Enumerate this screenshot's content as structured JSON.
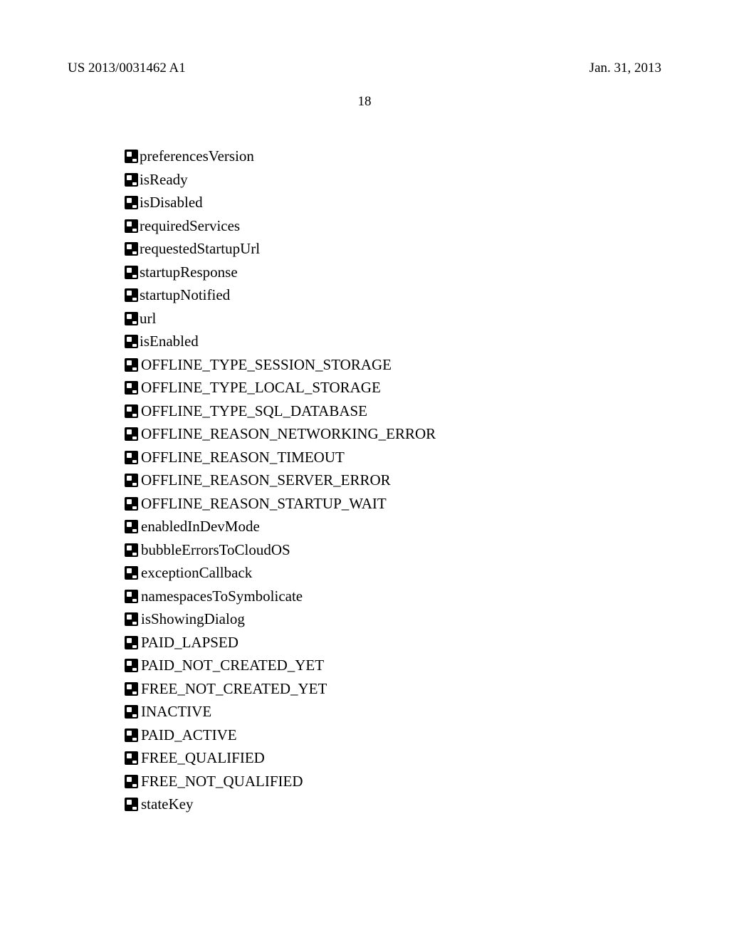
{
  "header": {
    "doc_number": "US 2013/0031462 A1",
    "date": "Jan. 31, 2013"
  },
  "page_number": "18",
  "properties": [
    {
      "label": "preferencesVersion",
      "spaced": false
    },
    {
      "label": "isReady",
      "spaced": false
    },
    {
      "label": "isDisabled",
      "spaced": false
    },
    {
      "label": "requiredServices",
      "spaced": false
    },
    {
      "label": "requestedStartupUrl",
      "spaced": false
    },
    {
      "label": "startupResponse",
      "spaced": false
    },
    {
      "label": "startupNotified",
      "spaced": false
    },
    {
      "label": "url",
      "spaced": false
    },
    {
      "label": "isEnabled",
      "spaced": false
    },
    {
      "label": "OFFLINE_TYPE_SESSION_STORAGE",
      "spaced": true
    },
    {
      "label": "OFFLINE_TYPE_LOCAL_STORAGE",
      "spaced": true
    },
    {
      "label": "OFFLINE_TYPE_SQL_DATABASE",
      "spaced": true
    },
    {
      "label": "OFFLINE_REASON_NETWORKING_ERROR",
      "spaced": true
    },
    {
      "label": "OFFLINE_REASON_TIMEOUT",
      "spaced": true
    },
    {
      "label": "OFFLINE_REASON_SERVER_ERROR",
      "spaced": true
    },
    {
      "label": "OFFLINE_REASON_STARTUP_WAIT",
      "spaced": true
    },
    {
      "label": "enabledInDevMode",
      "spaced": true
    },
    {
      "label": "bubbleErrorsToCloudOS",
      "spaced": true
    },
    {
      "label": "exceptionCallback",
      "spaced": true
    },
    {
      "label": "namespacesToSymbolicate",
      "spaced": true
    },
    {
      "label": "isShowingDialog",
      "spaced": true
    },
    {
      "label": "PAID_LAPSED",
      "spaced": true
    },
    {
      "label": "PAID_NOT_CREATED_YET",
      "spaced": true
    },
    {
      "label": "FREE_NOT_CREATED_YET",
      "spaced": true
    },
    {
      "label": "INACTIVE",
      "spaced": true
    },
    {
      "label": "PAID_ACTIVE",
      "spaced": true
    },
    {
      "label": "FREE_QUALIFIED",
      "spaced": true
    },
    {
      "label": "FREE_NOT_QUALIFIED",
      "spaced": true
    },
    {
      "label": "stateKey",
      "spaced": true
    }
  ]
}
